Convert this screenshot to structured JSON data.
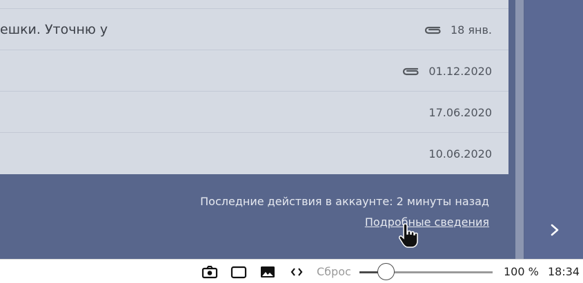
{
  "messages": [
    {
      "subject": "ешки. Уточню у",
      "has_attachment": true,
      "date": "18 янв."
    },
    {
      "subject": "",
      "has_attachment": true,
      "date": "01.12.2020"
    },
    {
      "subject": "",
      "has_attachment": false,
      "date": "17.06.2020"
    },
    {
      "subject": "",
      "has_attachment": false,
      "date": "10.06.2020"
    }
  ],
  "footer": {
    "last_activity": "Последние действия в аккаунте: 2 минуты назад",
    "details_link": "Подробные сведения"
  },
  "right_panel": {
    "next_icon": "chevron-right-icon"
  },
  "bottom_bar": {
    "icons": [
      "camera-icon",
      "window-icon",
      "image-icon",
      "code-icon"
    ],
    "reset_label": "Сброс",
    "zoom_level": 0.2,
    "zoom_value": "100 %",
    "clock": "18:34"
  },
  "colors": {
    "list_bg": "#d5dae3",
    "app_bg": "#58668c",
    "text_light": "#e6e9f0"
  }
}
